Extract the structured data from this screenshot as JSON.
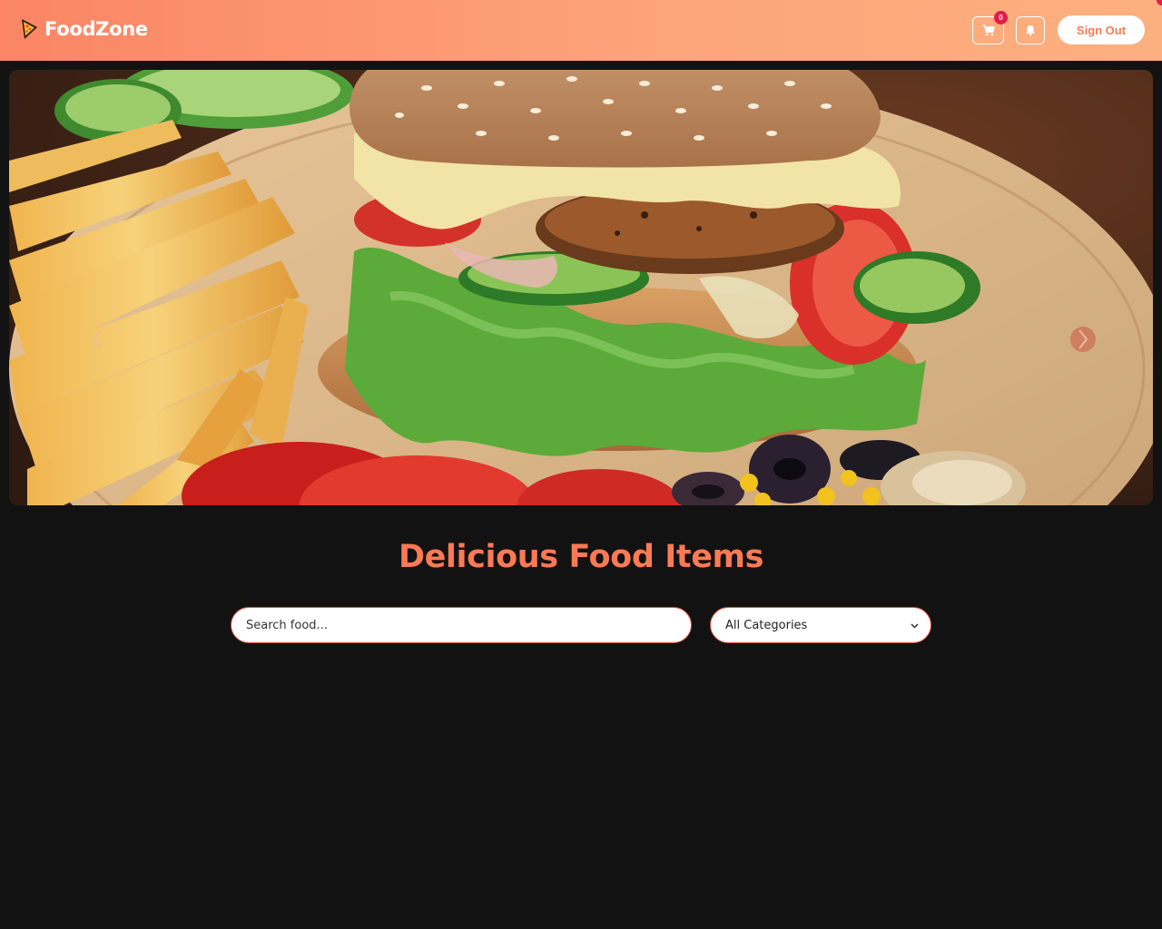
{
  "navbar": {
    "brand": "FoodZone",
    "cart_count": "0",
    "signout_label": "Sign Out"
  },
  "hero": {
    "slide_image": "burger-and-fries-photo"
  },
  "main": {
    "title": "Delicious Food Items",
    "search": {
      "placeholder": "Search food...",
      "value": ""
    },
    "category": {
      "selected": "All Categories"
    }
  },
  "colors": {
    "accent": "#fb7a55",
    "badge": "#e31c4a",
    "background": "#121212"
  }
}
